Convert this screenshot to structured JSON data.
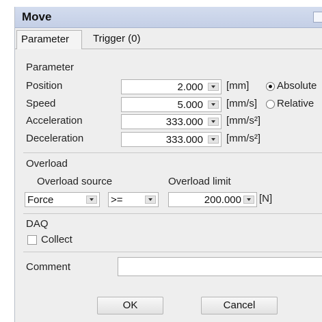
{
  "window": {
    "title": "Move"
  },
  "tabs": [
    {
      "label": "Parameter",
      "active": true
    },
    {
      "label": "Trigger (0)",
      "active": false
    }
  ],
  "parameter": {
    "section_label": "Parameter",
    "rows": [
      {
        "label": "Position",
        "value": "2.000",
        "unit": "[mm]"
      },
      {
        "label": "Speed",
        "value": "5.000",
        "unit": "[mm/s]"
      },
      {
        "label": "Acceleration",
        "value": "333.000",
        "unit": "[mm/s²]"
      },
      {
        "label": "Deceleration",
        "value": "333.000",
        "unit": "[mm/s²]"
      }
    ],
    "mode_options": [
      {
        "label": "Absolute",
        "selected": true
      },
      {
        "label": "Relative",
        "selected": false
      }
    ]
  },
  "overload": {
    "section_label": "Overload",
    "source_label": "Overload source",
    "limit_label": "Overload limit",
    "source_value": "Force",
    "operator_value": ">=",
    "limit_value": "200.000",
    "limit_unit": "[N]"
  },
  "daq": {
    "section_label": "DAQ",
    "collect_label": "Collect",
    "collect_checked": false
  },
  "comment": {
    "label": "Comment",
    "value": ""
  },
  "buttons": {
    "ok": "OK",
    "cancel": "Cancel"
  },
  "colors": {
    "titlebar": "#c9d3ea",
    "dialog_bg": "#eeeeee",
    "field_bg": "#ffffff"
  }
}
